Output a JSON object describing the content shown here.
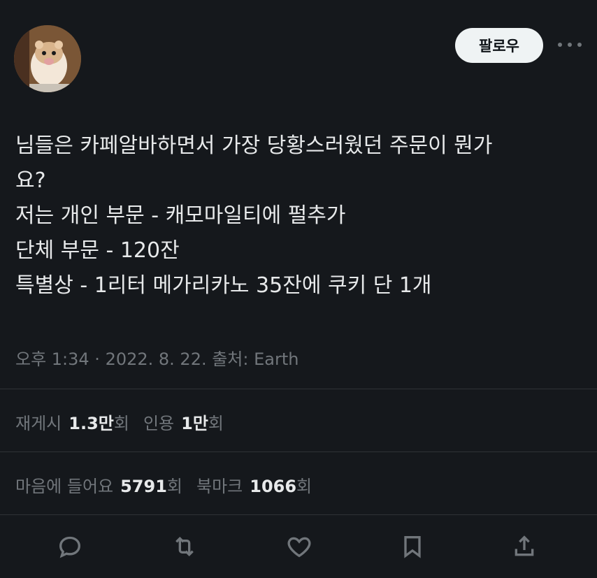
{
  "header": {
    "follow_label": "팔로우"
  },
  "tweet": {
    "text": "님들은 카페알바하면서 가장 당황스러웠던 주문이 뭔가\n요?\n저는 개인 부문 - 캐모마일티에 펄추가\n단체 부문 - 120잔\n특별상 - 1리터 메가리카노 35잔에 쿠키 단 1개",
    "meta": "오후 1:34 · 2022. 8. 22. 출처: Earth"
  },
  "stats": {
    "retweets_label": "재게시",
    "retweets_value": "1.3만",
    "retweets_unit": "회",
    "quotes_label": "인용",
    "quotes_value": "1만",
    "quotes_unit": "회",
    "likes_label": "마음에 들어요",
    "likes_value": "5791",
    "likes_unit": "회",
    "bookmarks_label": "북마크",
    "bookmarks_value": "1066",
    "bookmarks_unit": "회"
  },
  "icons": {
    "reply": "reply-icon",
    "retweet": "retweet-icon",
    "like": "heart-icon",
    "bookmark": "bookmark-icon",
    "share": "share-icon",
    "more": "more-icon"
  },
  "colors": {
    "background": "#15181c",
    "text": "#e7e9ea",
    "muted": "#71767b",
    "divider": "#2f3336",
    "follow_bg": "#eff3f4"
  }
}
